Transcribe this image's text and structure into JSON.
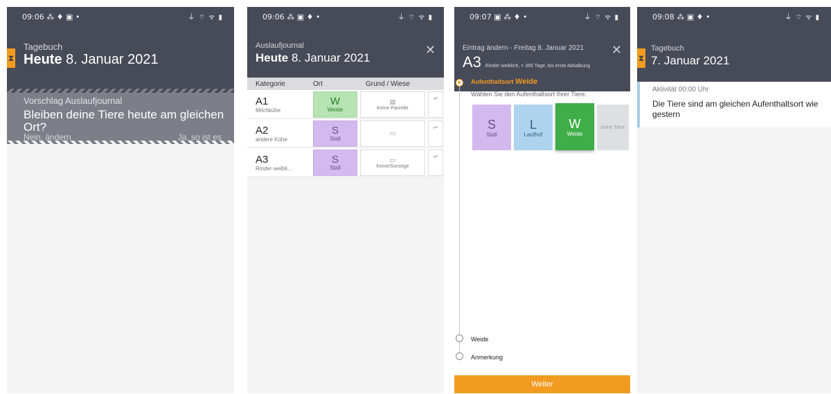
{
  "screen1": {
    "status": {
      "time": "09:06",
      "icons_left": "⁂ ♦ ▣ •",
      "icons_right": "⏚ ⌔ ᯤ ▮"
    },
    "header": {
      "small": "Tagebuch",
      "big_bold": "Heute",
      "big_rest": " 8. Januar 2021"
    },
    "suggestion": {
      "title": "Vorschlag Auslaufjournal",
      "question": "Bleiben deine Tiere heute am gleichen Ort?",
      "no": "Nein, ändern",
      "yes": "Ja, so ist es"
    }
  },
  "screen2": {
    "status": {
      "time": "09:06",
      "icons_left": "⁂ ▣ ♦ •",
      "icons_right": "⏚ ⌔ ᯤ ▮"
    },
    "header": {
      "small": "Auslaufjournal",
      "big_bold": "Heute",
      "big_rest": " 8. Januar 2021",
      "close": "✕"
    },
    "columns": [
      "Kategorie",
      "Ort",
      "Grund / Wiese"
    ],
    "rows": [
      {
        "code": "A1",
        "desc": "Milchkühe",
        "letter": "W",
        "word": "Weide",
        "grund_icon": "▤",
        "grund": "Keine Parzelle",
        "extra": "⇌"
      },
      {
        "code": "A2",
        "desc": "andere Kühe",
        "letter": "S",
        "word": "Stall",
        "grund_icon": "▭",
        "grund": "",
        "extra": "⇌"
      },
      {
        "code": "A3",
        "desc": "Rinder weibli...",
        "letter": "S",
        "word": "Stall",
        "grund_icon": "▭",
        "grund": "Keine/Sonstige",
        "extra": "⇌"
      }
    ]
  },
  "screen3": {
    "status": {
      "time": "09:07",
      "icons_left": "▣ ⁂ ♦ •",
      "icons_right": "⏚ ⌔ ᯤ ▮"
    },
    "header": {
      "small": "Eintrag ändern - Freitag 8. Januar 2021",
      "code": "A3",
      "sub": "Rinder weiblich, > 365 Tage, bis erste Abkalbung",
      "close": "✕"
    },
    "step_title": "Aufenthaltsort",
    "step_value": "Weide",
    "hint": "Wählen Sie den Aufenthaltsort Ihrer Tiere.",
    "options": [
      {
        "letter": "S",
        "word": "Stall"
      },
      {
        "letter": "L",
        "word": "Laufhof"
      },
      {
        "letter": "W",
        "word": "Weide"
      },
      {
        "letter": "",
        "word": "keine Tiere"
      }
    ],
    "steps": [
      "Weide",
      "Anmerkung"
    ],
    "button": "Weiter"
  },
  "screen4": {
    "status": {
      "time": "09:08",
      "icons_left": "⁂ ▣ ♦ •",
      "icons_right": "⏚ ⌔ ᯤ ▮"
    },
    "header": {
      "small": "Tagebuch",
      "big": "7. Januar 2021"
    },
    "entry": {
      "time": "Aktivität 00:00 Uhr",
      "message": "Die Tiere sind am gleichen Aufenthaltsort wie gestern"
    }
  }
}
